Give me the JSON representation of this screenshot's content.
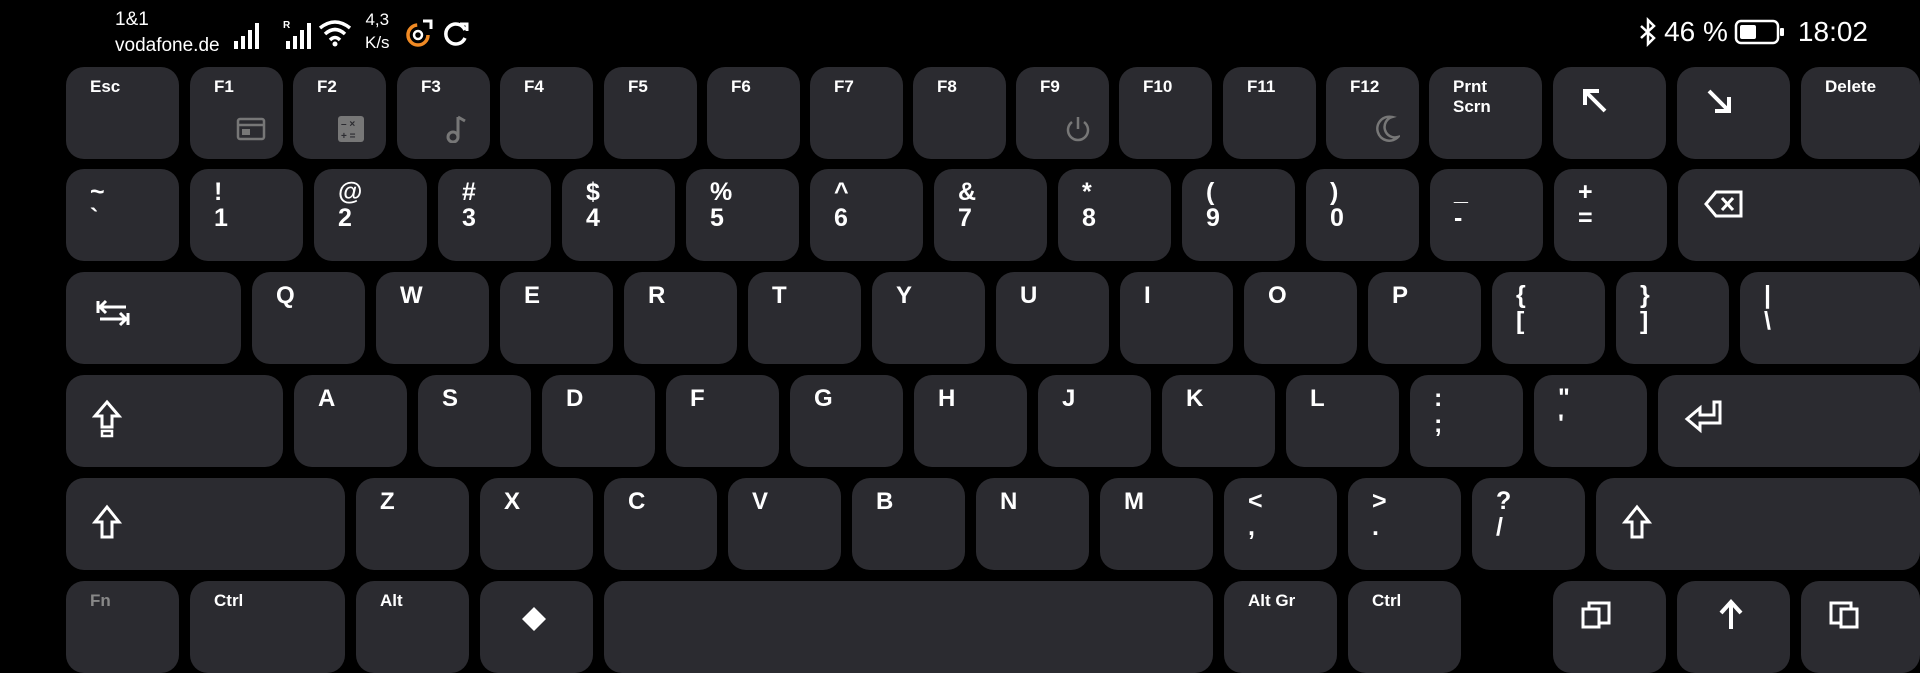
{
  "status": {
    "carrier_1": "1&1",
    "carrier_2": "vodafone.de",
    "speed_value": "4,3",
    "speed_unit": "K/s",
    "battery": "46 %",
    "time": "18:02"
  },
  "keys": {
    "esc": "Esc",
    "f1": "F1",
    "f2": "F2",
    "f3": "F3",
    "f4": "F4",
    "f5": "F5",
    "f6": "F6",
    "f7": "F7",
    "f8": "F8",
    "f9": "F9",
    "f10": "F10",
    "f11": "F11",
    "f12": "F12",
    "prnt": "Prnt",
    "scrn": "Scrn",
    "delete": "Delete",
    "tilde_top": "~",
    "tilde_bot": "`",
    "n1_top": "!",
    "n1_bot": "1",
    "n2_top": "@",
    "n2_bot": "2",
    "n3_top": "#",
    "n3_bot": "3",
    "n4_top": "$",
    "n4_bot": "4",
    "n5_top": "%",
    "n5_bot": "5",
    "n6_top": "^",
    "n6_bot": "6",
    "n7_top": "&",
    "n7_bot": "7",
    "n8_top": "*",
    "n8_bot": "8",
    "n9_top": "(",
    "n9_bot": "9",
    "n0_top": ")",
    "n0_bot": "0",
    "minus_top": "_",
    "minus_bot": "-",
    "plus_top": "+",
    "plus_bot": "=",
    "q": "Q",
    "w": "W",
    "e": "E",
    "r": "R",
    "t": "T",
    "y": "Y",
    "u": "U",
    "i": "I",
    "o": "O",
    "p": "P",
    "lbrace_top": "{",
    "lbrace_bot": "[",
    "rbrace_top": "}",
    "rbrace_bot": "]",
    "pipe_top": "|",
    "pipe_bot": "\\",
    "a": "A",
    "s": "S",
    "d": "D",
    "f": "F",
    "g": "G",
    "h": "H",
    "j": "J",
    "k": "K",
    "l": "L",
    "colon_top": ":",
    "colon_bot": ";",
    "quote_top": "\"",
    "quote_bot": "'",
    "z": "Z",
    "x": "X",
    "c": "C",
    "v": "V",
    "b": "B",
    "n": "N",
    "m": "M",
    "lt_top": "<",
    "lt_bot": ",",
    "gt_top": ">",
    "gt_bot": ".",
    "q_top": "?",
    "q_bot": "/",
    "fn": "Fn",
    "ctrl": "Ctrl",
    "alt": "Alt",
    "altgr": "Alt Gr",
    "ctrl_r": "Ctrl"
  }
}
